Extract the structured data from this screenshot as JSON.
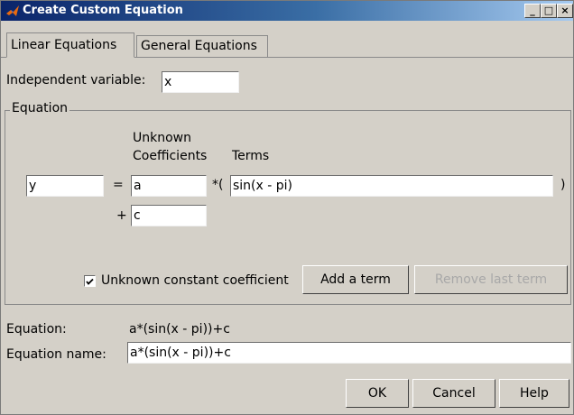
{
  "window": {
    "title": "Create Custom Equation",
    "min_glyph": "_",
    "max_glyph": "□",
    "close_glyph": "×"
  },
  "tabs": [
    {
      "label": "Linear Equations"
    },
    {
      "label": "General Equations"
    }
  ],
  "independent_variable": {
    "label": "Independent variable:",
    "value": "x"
  },
  "equation_group": {
    "legend": "Equation",
    "col_unknown_line1": "Unknown",
    "col_unknown_line2": "Coefficients",
    "col_terms": "Terms",
    "lhs_value": "y",
    "equals": "=",
    "coef1_value": "a",
    "times_open": "*(",
    "term1_value": "sin(x - pi)",
    "close_paren": ")",
    "plus": "+",
    "coef2_value": "c",
    "constant_checkbox_label": "Unknown constant coefficient",
    "constant_checked": true,
    "add_term_label": "Add a term",
    "remove_term_label": "Remove last term"
  },
  "equation_display": {
    "label": "Equation:",
    "value": "a*(sin(x - pi))+c"
  },
  "equation_name": {
    "label": "Equation name:",
    "value": "a*(sin(x - pi))+c"
  },
  "buttons": {
    "ok": "OK",
    "cancel": "Cancel",
    "help": "Help"
  }
}
